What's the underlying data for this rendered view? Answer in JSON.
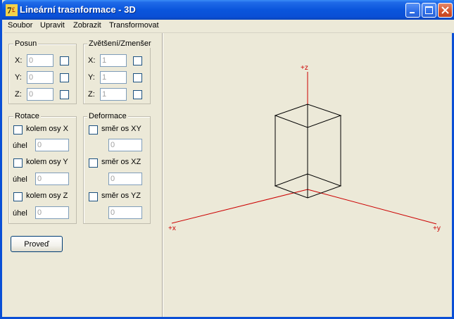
{
  "window": {
    "title": "Lineární trasnformace - 3D",
    "app_icon": "turbo-pascal-icon",
    "controls": {
      "minimize": "minimize-icon",
      "maximize": "maximize-icon",
      "close": "close-icon"
    }
  },
  "menu": [
    "Soubor",
    "Upravit",
    "Zobrazit",
    "Transformovat"
  ],
  "posun": {
    "title": "Posun",
    "rows": [
      {
        "label": "X:",
        "value": "0",
        "checked": false
      },
      {
        "label": "Y:",
        "value": "0",
        "checked": false
      },
      {
        "label": "Z:",
        "value": "0",
        "checked": false
      }
    ]
  },
  "scale": {
    "title": "Zvětšení/Zmenšer",
    "rows": [
      {
        "label": "X:",
        "value": "1",
        "checked": false
      },
      {
        "label": "Y:",
        "value": "1",
        "checked": false
      },
      {
        "label": "Z:",
        "value": "1",
        "checked": false
      }
    ]
  },
  "rotace": {
    "title": "Rotace",
    "items": [
      {
        "check_label": "kolem osy X",
        "angle_label": "úhel",
        "value": "0"
      },
      {
        "check_label": "kolem osy Y",
        "angle_label": "úhel",
        "value": "0"
      },
      {
        "check_label": "kolem osy Z",
        "angle_label": "úhel",
        "value": "0"
      }
    ]
  },
  "deformace": {
    "title": "Deformace",
    "items": [
      {
        "check_label": "směr os XY",
        "value": "0"
      },
      {
        "check_label": "směr os XZ",
        "value": "0"
      },
      {
        "check_label": "směr os YZ",
        "value": "0"
      }
    ]
  },
  "execute_button": "Proveď",
  "axes": {
    "z_label": "+z",
    "x_label": "+x",
    "y_label": "+y",
    "color": "#cc0000"
  },
  "colors": {
    "titlebar": "#0a55dc",
    "face": "#ece9d8",
    "axis": "#cc0000",
    "cube": "#000000"
  }
}
